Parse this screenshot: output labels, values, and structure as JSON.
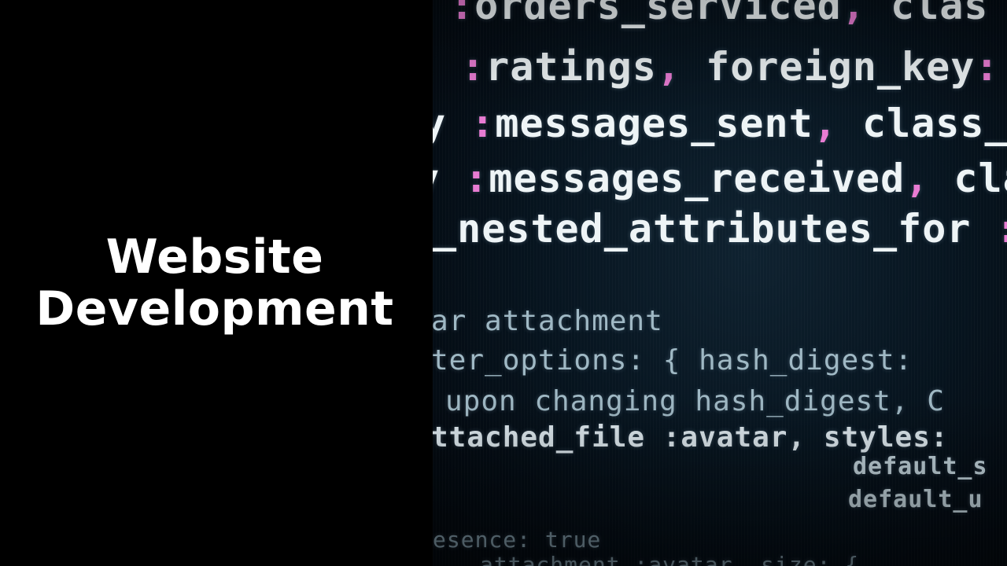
{
  "slide": {
    "title_line1": "Website",
    "title_line2": "Development"
  },
  "code_image": {
    "lines": [
      ":orders_serviced, clas",
      ":ratings, foreign_key:",
      "y :messages_sent, class_n",
      "y :messages_received, cla",
      "_nested_attributes_for :ph",
      "ar attachment",
      "ter_options: { hash_digest:",
      "upon changing hash_digest, C",
      "ttached_file :avatar, styles:",
      "default_s",
      "default_u",
      "esence: true",
      "attachment :avatar, size: {"
    ]
  }
}
